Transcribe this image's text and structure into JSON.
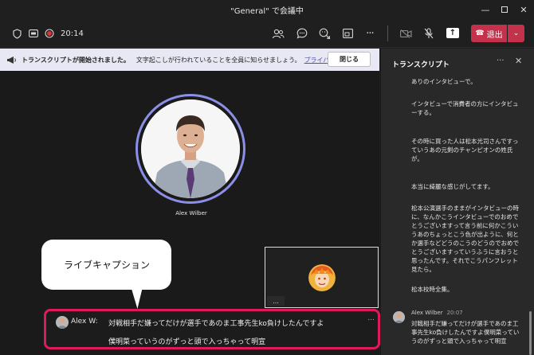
{
  "window": {
    "title": "\"General\" で会議中"
  },
  "toolbar": {
    "timer": "20:14",
    "leave_label": "退出"
  },
  "banner": {
    "title": "トランスクリプトが開始されました。",
    "message": "文字起こしが行われていることを全員に知らせましょう。",
    "link": "プライバシー ポリシー",
    "close_label": "閉じる"
  },
  "stage": {
    "main_participant_name": "Alex Wilber",
    "pip_more": "..."
  },
  "callout": {
    "label": "ライブキャプション"
  },
  "caption": {
    "speaker": "Alex W:",
    "line1": "対戦相手だ嫌ってだけが選手であのま工事先生ko負けしたんですよ",
    "line2": "僕明菜っていうのがずっと頭で入っちゃって明宣",
    "more": "..."
  },
  "transcript": {
    "title": "トランスクリプト",
    "entries": [
      "ありのインタビューで。",
      "インタビューで消費者の方にインタビューする。",
      "その時に買った人は松本光司さんですっていうあの元剣のチャンピオンの姓氏が。",
      "本当に綺麗な感じがしてます。",
      "松本公演選手のままがインタビューの時に、なんかこうインタビューでのおめでとうございますって言う前に何かこういうあのちょっとこう色が出ように、何とか選手などどうのこうのどうのでおめでとうございますっていうふうに言おうと思ったんです。それでこうパンフレット見たら。",
      "松本校時全集。"
    ],
    "last_speaker": "Alex Wilber",
    "last_time": "20:07",
    "last_text": "対戦相手だ嫌ってだけが選手であのま工事先生ko負けしたんですよ僕明菜っていうのがずっと頭で入っちゃって明宣"
  },
  "colors": {
    "leave": "#c4314b",
    "caption_border": "#e0185e",
    "ring": "#8c8fe8",
    "banner_bg": "#e8e8f4"
  }
}
